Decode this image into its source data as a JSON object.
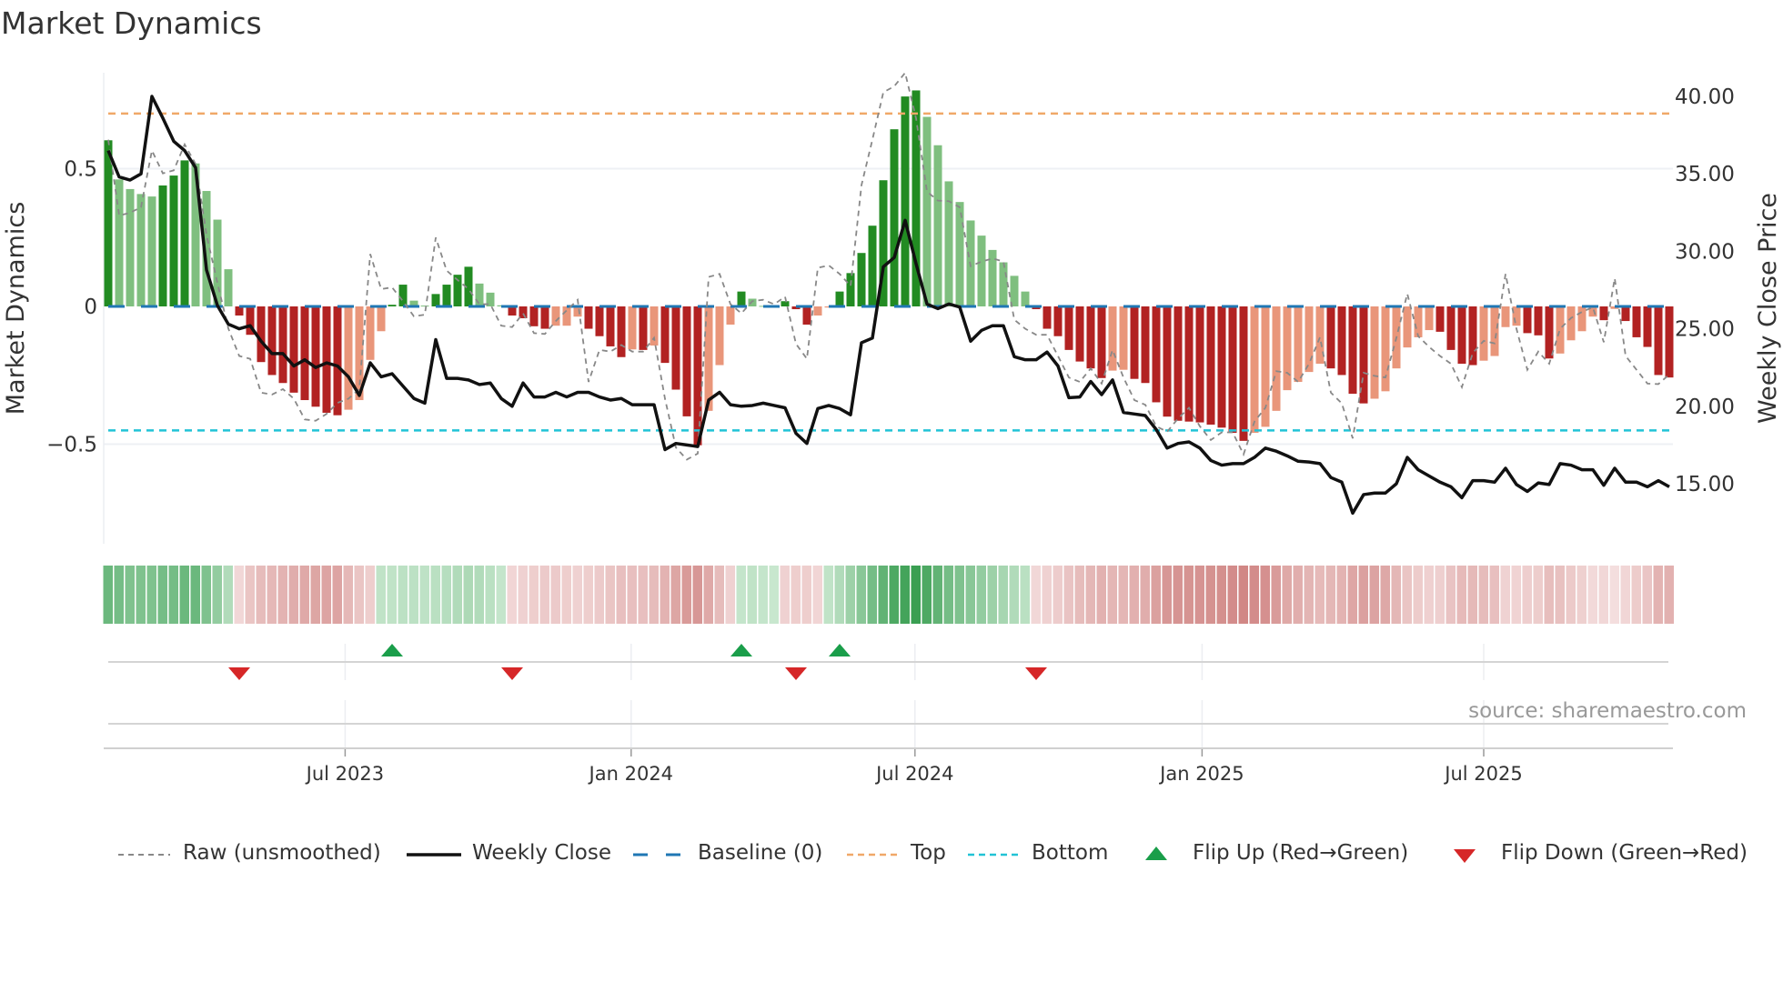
{
  "title": "Market Dynamics",
  "source": "source: sharemaestro.com",
  "colors": {
    "up_strong": "#228b22",
    "up_weak": "#7fbf7f",
    "down_strong": "#b22222",
    "down_weak": "#e9967a",
    "close": "#111111",
    "raw": "#888888",
    "baseline": "#1f77b4",
    "top": "#f0a868",
    "bottom": "#22c3d6",
    "flip_up": "#1a9e4a",
    "flip_down": "#d62728"
  },
  "legend": [
    {
      "label": "Raw (unsmoothed)",
      "icon": "dotted-gray-line"
    },
    {
      "label": "Weekly Close",
      "icon": "solid-black-line"
    },
    {
      "label": "Baseline (0)",
      "icon": "dashed-blue-line"
    },
    {
      "label": "Top",
      "icon": "dotted-orange-line"
    },
    {
      "label": "Bottom",
      "icon": "dotted-cyan-line"
    },
    {
      "label": "Flip Up (Red→Green)",
      "icon": "green-triangle-up"
    },
    {
      "label": "Flip Down (Green→Red)",
      "icon": "red-triangle-down"
    }
  ],
  "chart_data": {
    "type": "bar",
    "title": "Market Dynamics",
    "ylabel": "Market Dynamics",
    "y2label": "Weekly Close Price",
    "ylim": [
      -0.87,
      0.7
    ],
    "y2lim": [
      11.0,
      42.0
    ],
    "y_ticks": [
      "0.5",
      "0",
      "−0.5"
    ],
    "y_tick_values": [
      0.5,
      0,
      -0.5
    ],
    "y2_ticks": [
      "40.00",
      "35.00",
      "30.00",
      "25.00",
      "20.00",
      "15.00"
    ],
    "y2_tick_values": [
      40,
      35,
      30,
      25,
      20,
      15
    ],
    "x_unit": "week index",
    "x_ticks": [
      {
        "label": "Jul 2023",
        "week": 21.7
      },
      {
        "label": "Jan 2024",
        "week": 47.9
      },
      {
        "label": "Jul 2024",
        "week": 73.9
      },
      {
        "label": "Jan 2025",
        "week": 100.2
      },
      {
        "label": "Jul 2025",
        "week": 126.0
      }
    ],
    "top_level": 0.7,
    "bottom_level": -0.45,
    "baseline": 0,
    "grid": true,
    "legend_position": "bottom",
    "momentum": [
      0.603,
      0.461,
      0.426,
      0.408,
      0.399,
      0.439,
      0.475,
      0.53,
      0.519,
      0.419,
      0.315,
      0.135,
      -0.033,
      -0.103,
      -0.202,
      -0.249,
      -0.278,
      -0.313,
      -0.34,
      -0.364,
      -0.386,
      -0.395,
      -0.375,
      -0.34,
      -0.194,
      -0.09,
      0.006,
      0.079,
      0.021,
      0.003,
      0.045,
      0.079,
      0.115,
      0.144,
      0.083,
      0.05,
      0.004,
      -0.033,
      -0.043,
      -0.072,
      -0.081,
      -0.07,
      -0.07,
      -0.037,
      -0.081,
      -0.108,
      -0.145,
      -0.184,
      -0.156,
      -0.158,
      -0.142,
      -0.205,
      -0.302,
      -0.399,
      -0.504,
      -0.379,
      -0.213,
      -0.066,
      0.054,
      0.028,
      0.002,
      0.001,
      0.019,
      -0.01,
      -0.066,
      -0.033,
      -0.004,
      0.054,
      0.121,
      0.194,
      0.293,
      0.458,
      0.643,
      0.762,
      0.784,
      0.688,
      0.585,
      0.454,
      0.379,
      0.312,
      0.257,
      0.205,
      0.16,
      0.111,
      0.054,
      -0.01,
      -0.081,
      -0.108,
      -0.158,
      -0.2,
      -0.225,
      -0.26,
      -0.233,
      -0.23,
      -0.263,
      -0.278,
      -0.348,
      -0.4,
      -0.415,
      -0.418,
      -0.421,
      -0.429,
      -0.44,
      -0.459,
      -0.488,
      -0.459,
      -0.437,
      -0.379,
      -0.304,
      -0.274,
      -0.238,
      -0.208,
      -0.225,
      -0.249,
      -0.317,
      -0.352,
      -0.335,
      -0.308,
      -0.225,
      -0.149,
      -0.112,
      -0.086,
      -0.092,
      -0.158,
      -0.208,
      -0.213,
      -0.197,
      -0.18,
      -0.075,
      -0.07,
      -0.097,
      -0.105,
      -0.189,
      -0.171,
      -0.123,
      -0.09,
      -0.037,
      -0.05,
      -0.009,
      -0.053,
      -0.112,
      -0.147,
      -0.249,
      -0.258
    ],
    "raw": [
      0.605,
      0.33,
      0.34,
      0.36,
      0.566,
      0.483,
      0.494,
      0.588,
      0.517,
      0.26,
      0.085,
      -0.08,
      -0.18,
      -0.19,
      -0.313,
      -0.32,
      -0.3,
      -0.335,
      -0.41,
      -0.415,
      -0.39,
      -0.35,
      -0.335,
      -0.3,
      0.19,
      0.063,
      0.069,
      0.019,
      -0.036,
      -0.03,
      0.25,
      0.13,
      0.096,
      0.063,
      0.008,
      0.008,
      -0.07,
      -0.075,
      -0.025,
      -0.097,
      -0.1,
      -0.053,
      -0.014,
      0.024,
      -0.274,
      -0.158,
      -0.164,
      -0.14,
      -0.164,
      -0.164,
      -0.114,
      -0.335,
      -0.512,
      -0.556,
      -0.534,
      0.107,
      0.118,
      0.008,
      -0.025,
      0.019,
      0.024,
      0.008,
      0.035,
      -0.136,
      -0.19,
      0.14,
      0.149,
      0.118,
      0.074,
      0.44,
      0.605,
      0.777,
      0.799,
      0.848,
      0.683,
      0.417,
      0.384,
      0.382,
      0.36,
      0.146,
      0.163,
      0.174,
      0.163,
      -0.048,
      -0.081,
      -0.103,
      -0.103,
      -0.18,
      -0.258,
      -0.274,
      -0.225,
      -0.28,
      -0.158,
      -0.258,
      -0.34,
      -0.357,
      -0.435,
      -0.455,
      -0.407,
      -0.368,
      -0.435,
      -0.485,
      -0.457,
      -0.457,
      -0.537,
      -0.418,
      -0.368,
      -0.235,
      -0.241,
      -0.274,
      -0.208,
      -0.112,
      -0.313,
      -0.352,
      -0.479,
      -0.241,
      -0.252,
      -0.258,
      -0.114,
      0.046,
      -0.108,
      -0.147,
      -0.18,
      -0.208,
      -0.293,
      -0.169,
      -0.125,
      -0.134,
      0.118,
      -0.081,
      -0.23,
      -0.164,
      -0.208,
      -0.081,
      -0.042,
      -0.02,
      -0.003,
      -0.13,
      0.102,
      -0.18,
      -0.23,
      -0.28,
      -0.282,
      -0.247
    ],
    "weekly_close": [
      36.5,
      34.8,
      34.6,
      35.0,
      40.0,
      38.6,
      37.1,
      36.5,
      35.4,
      28.8,
      26.5,
      25.3,
      25.0,
      25.2,
      24.2,
      23.4,
      23.4,
      22.6,
      23.0,
      22.5,
      22.8,
      22.6,
      21.9,
      20.7,
      22.8,
      21.9,
      22.1,
      21.3,
      20.5,
      20.2,
      24.3,
      21.8,
      21.8,
      21.7,
      21.4,
      21.5,
      20.5,
      20.0,
      21.5,
      20.6,
      20.6,
      20.9,
      20.6,
      20.9,
      20.9,
      20.6,
      20.4,
      20.5,
      20.1,
      20.1,
      20.1,
      17.2,
      17.6,
      17.5,
      17.4,
      20.4,
      20.9,
      20.1,
      20.0,
      20.05,
      20.2,
      20.05,
      19.9,
      18.25,
      17.6,
      19.85,
      20.05,
      19.85,
      19.45,
      24.1,
      24.4,
      29.0,
      29.6,
      32.0,
      29.2,
      26.6,
      26.3,
      26.6,
      26.4,
      24.2,
      24.9,
      25.2,
      25.2,
      23.2,
      23.0,
      23.0,
      23.5,
      22.6,
      20.55,
      20.6,
      21.6,
      20.75,
      21.7,
      19.6,
      19.5,
      19.4,
      18.5,
      17.3,
      17.6,
      17.7,
      17.3,
      16.5,
      16.2,
      16.3,
      16.3,
      16.7,
      17.3,
      17.1,
      16.8,
      16.45,
      16.4,
      16.3,
      15.4,
      15.1,
      13.1,
      14.3,
      14.4,
      14.4,
      15.0,
      16.7,
      15.9,
      15.5,
      15.1,
      14.8,
      14.1,
      15.2,
      15.2,
      15.1,
      16.0,
      14.95,
      14.5,
      15.05,
      14.95,
      16.3,
      16.2,
      15.9,
      15.9,
      14.9,
      16.0,
      15.1,
      15.1,
      14.8,
      15.2,
      14.8
    ],
    "heat": [
      0.55,
      0.5,
      0.45,
      0.45,
      0.45,
      0.5,
      0.5,
      0.55,
      0.55,
      0.45,
      0.35,
      0.2,
      -0.05,
      -0.15,
      -0.2,
      -0.22,
      -0.25,
      -0.28,
      -0.3,
      -0.32,
      -0.33,
      -0.33,
      -0.22,
      -0.15,
      -0.1,
      0.12,
      0.12,
      0.14,
      0.14,
      0.13,
      0.15,
      0.17,
      0.2,
      0.22,
      0.2,
      0.15,
      0.1,
      -0.06,
      -0.08,
      -0.1,
      -0.12,
      -0.12,
      -0.1,
      -0.08,
      -0.1,
      -0.12,
      -0.15,
      -0.18,
      -0.18,
      -0.18,
      -0.2,
      -0.25,
      -0.32,
      -0.38,
      -0.4,
      -0.3,
      -0.2,
      -0.08,
      0.1,
      0.12,
      0.1,
      0.08,
      -0.08,
      -0.1,
      -0.1,
      -0.06,
      0.12,
      0.2,
      0.3,
      0.4,
      0.5,
      0.6,
      0.7,
      0.75,
      0.8,
      0.7,
      0.6,
      0.5,
      0.45,
      0.4,
      0.35,
      0.3,
      0.25,
      0.2,
      0.15,
      -0.05,
      -0.081,
      -0.108,
      -0.158,
      -0.2,
      -0.225,
      -0.26,
      -0.233,
      -0.23,
      -0.263,
      -0.278,
      -0.348,
      -0.4,
      -0.415,
      -0.418,
      -0.421,
      -0.429,
      -0.44,
      -0.459,
      -0.488,
      -0.459,
      -0.437,
      -0.379,
      -0.304,
      -0.274,
      -0.238,
      -0.208,
      -0.225,
      -0.249,
      -0.317,
      -0.352,
      -0.335,
      -0.308,
      -0.225,
      -0.149,
      -0.112,
      -0.086,
      -0.092,
      -0.158,
      -0.208,
      -0.213,
      -0.197,
      -0.18,
      -0.075,
      -0.07,
      -0.097,
      -0.105,
      -0.189,
      -0.171,
      -0.123,
      -0.09,
      -0.037,
      -0.05,
      -0.009,
      -0.053,
      -0.112,
      -0.147,
      -0.249,
      -0.258
    ],
    "flip_up_weeks": [
      26,
      58,
      67
    ],
    "flip_down_weeks": [
      12,
      37,
      63,
      85
    ]
  }
}
